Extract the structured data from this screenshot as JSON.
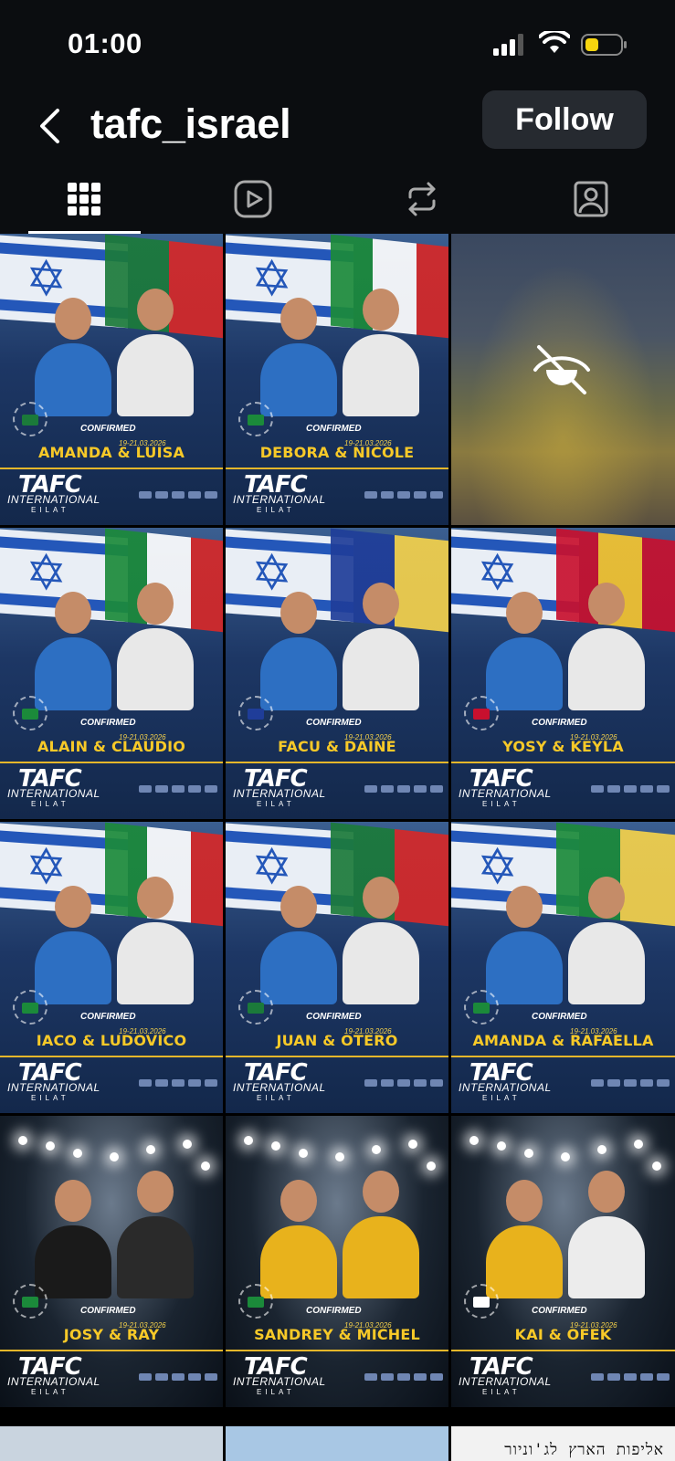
{
  "status_bar": {
    "time": "01:00"
  },
  "header": {
    "username": "tafc_israel",
    "follow_label": "Follow"
  },
  "tabs": [
    {
      "name": "posts-grid",
      "icon": "grid-icon",
      "active": true
    },
    {
      "name": "reels",
      "icon": "reels-icon",
      "active": false
    },
    {
      "name": "reposts",
      "icon": "repost-icon",
      "active": false
    },
    {
      "name": "tagged",
      "icon": "tagged-person-icon",
      "active": false
    }
  ],
  "poster_common": {
    "confirmed": "CONFIRMED",
    "date": "19-21.03.2026",
    "logo": "TAFC",
    "logo_sub": "INTERNATIONAL",
    "logo_city": "EILAT"
  },
  "posts": [
    {
      "names": "AMANDA & LUISA",
      "flag_colors": [
        "#1b7a3a",
        "#d62828"
      ]
    },
    {
      "names": "DEBORA & NICOLE",
      "flag_colors": [
        "#1b8a3a",
        "#ffffff",
        "#d62828"
      ]
    },
    {
      "hidden": true
    },
    {
      "names": "ALAIN & CLAUDIO",
      "flag_colors": [
        "#1b8a3a",
        "#ffffff",
        "#d62828"
      ]
    },
    {
      "names": "FACU & DAINE",
      "flag_colors": [
        "#1f3d99",
        "#f4d14b"
      ]
    },
    {
      "names": "YOSY & KEYLA",
      "flag_colors": [
        "#c8102e",
        "#f4c430",
        "#c8102e"
      ]
    },
    {
      "names": "IACO & LUDOVICO",
      "flag_colors": [
        "#1b8a3a",
        "#ffffff",
        "#d62828"
      ]
    },
    {
      "names": "JUAN & OTERO",
      "flag_colors": [
        "#1b7a3a",
        "#d62828"
      ]
    },
    {
      "names": "AMANDA & RAFAELLA",
      "flag_colors": [
        "#1b8a3a",
        "#f4d14b"
      ]
    },
    {
      "names": "JOSY & RAY",
      "flag_colors": [
        "#1b8a3a",
        "#f4d14b"
      ]
    },
    {
      "names": "SANDREY & MICHEL",
      "flag_colors": [
        "#1b8a3a",
        "#f4d14b"
      ]
    },
    {
      "names": "KAI & OFEK",
      "flag_colors": [
        "#ffffff",
        "#2457b9"
      ]
    }
  ],
  "partial_row": {
    "third_text": "אליפות הארץ לג'וניור"
  }
}
